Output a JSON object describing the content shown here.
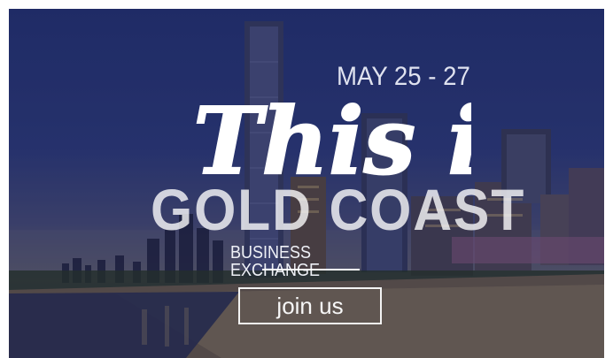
{
  "banner": {
    "date": "MAY 25 - 27",
    "script_title": "This is",
    "headline": "GOLD COAST",
    "subtitle": "BUSINESS EXCHANGE",
    "cta_label": "join us"
  }
}
